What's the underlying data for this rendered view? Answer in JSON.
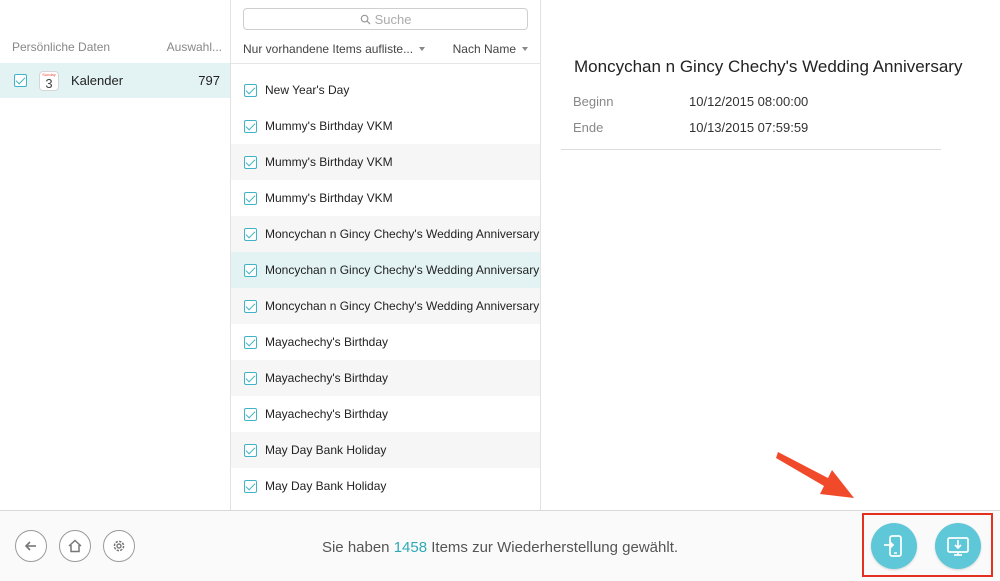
{
  "sidebar": {
    "header_left": "Persönliche Daten",
    "header_right": "Auswahl...",
    "item": {
      "label": "Kalender",
      "count": "797",
      "icon_day": "3",
      "icon_head": "Sunday"
    }
  },
  "list": {
    "search_placeholder": "Suche",
    "filter_left": "Nur vorhandene Items aufliste...",
    "filter_right": "Nach Name",
    "items": [
      "New Year's Day",
      "Mummy's Birthday VKM",
      "Mummy's Birthday VKM",
      "Mummy's Birthday VKM",
      "Moncychan n Gincy Chechy's Wedding Anniversary",
      "Moncychan n Gincy Chechy's Wedding Anniversary",
      "Moncychan n Gincy Chechy's Wedding Anniversary",
      "Mayachechy's Birthday",
      "Mayachechy's Birthday",
      "Mayachechy's Birthday",
      "May Day Bank Holiday",
      "May Day Bank Holiday"
    ]
  },
  "detail": {
    "title": "Moncychan n Gincy Chechy's Wedding Anniversary",
    "begin_label": "Beginn",
    "begin_value": "10/12/2015 08:00:00",
    "end_label": "Ende",
    "end_value": "10/13/2015 07:59:59"
  },
  "status": {
    "prefix": "Sie haben",
    "count": "1458",
    "suffix": "Items zur Wiederherstellung gewählt."
  },
  "icons": {
    "back": "back-arrow-icon",
    "home": "home-icon",
    "settings": "gear-icon",
    "to_device": "to-device-icon",
    "to_computer": "to-computer-icon"
  },
  "colors": {
    "accent": "#2ea9b5",
    "selection": "#e3f3f3",
    "action_button": "#5ec7d8",
    "highlight": "#e4301f"
  }
}
